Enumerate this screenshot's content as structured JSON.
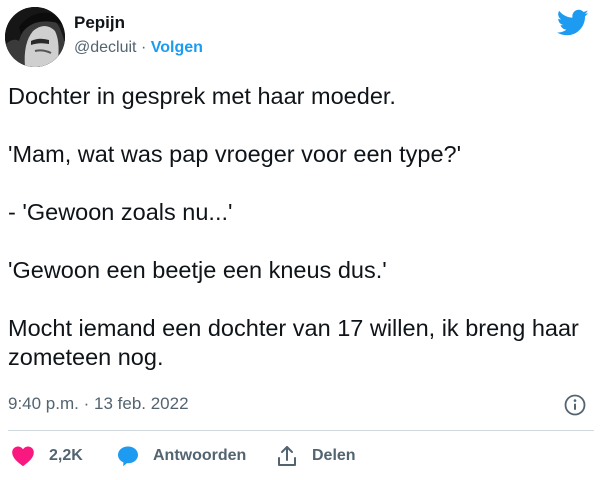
{
  "author": {
    "name": "Pepijn",
    "handle": "@decluit",
    "separator": "·",
    "follow_label": "Volgen"
  },
  "tweet": {
    "paragraphs": [
      "Dochter in gesprek met haar moeder.",
      "'Mam, wat was pap vroeger voor een type?'",
      "- 'Gewoon zoals nu...'",
      "'Gewoon een beetje een kneus dus.'",
      "Mocht iemand een dochter van 17 willen, ik breng haar zometeen nog."
    ],
    "time": "9:40 p.m.",
    "date_separator": "·",
    "date": "13 feb. 2022"
  },
  "actions": {
    "like_count": "2,2K",
    "reply_label": "Antwoorden",
    "share_label": "Delen"
  },
  "colors": {
    "twitter_blue": "#1d9bf0",
    "like_red": "#f91880",
    "secondary_text": "#536471"
  },
  "icons": {
    "brand": "twitter-bird-icon",
    "info": "info-icon",
    "like": "heart-icon",
    "reply": "speech-bubble-icon",
    "share": "share-arrow-icon"
  }
}
